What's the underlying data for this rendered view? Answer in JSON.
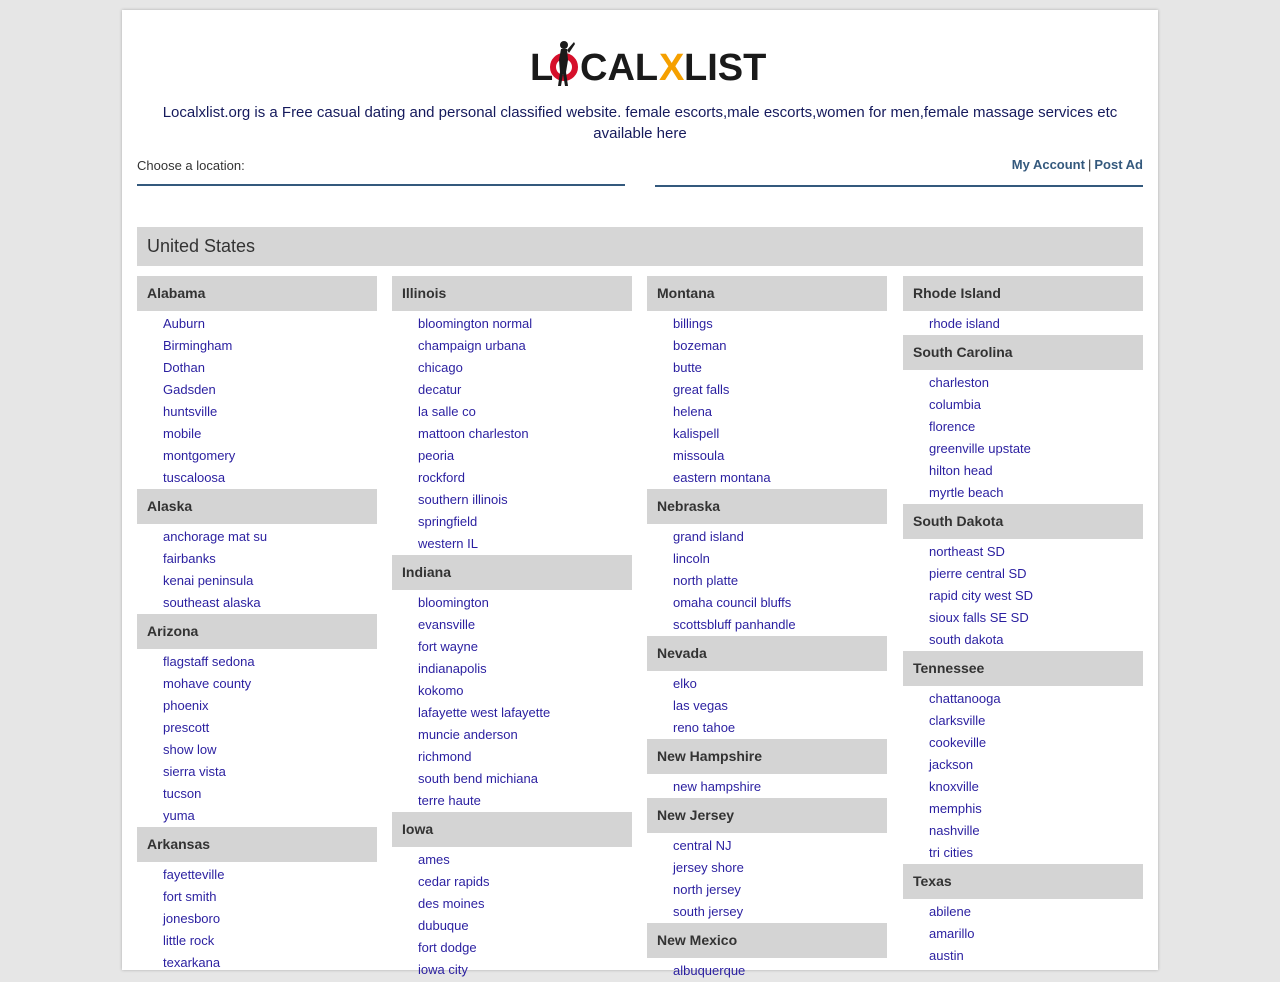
{
  "logo": {
    "text_left": "L",
    "text_o": "O",
    "text_cal": "CAL",
    "text_x": "X",
    "text_list": "LIST",
    "alt": "LOCALXLIST"
  },
  "tagline": "Localxlist.org is a Free casual dating and personal classified website. female escorts,male escorts,women for men,female massage services etc available here",
  "location": {
    "label": "Choose a location:"
  },
  "account": {
    "my_account": "My Account",
    "separator": "|",
    "post_ad": "Post Ad"
  },
  "country": "United States",
  "columns": [
    [
      {
        "state": "Alabama",
        "cities": [
          "Auburn",
          "Birmingham",
          "Dothan",
          "Gadsden",
          "huntsville",
          "mobile",
          "montgomery",
          "tuscaloosa"
        ]
      },
      {
        "state": "Alaska",
        "cities": [
          "anchorage mat su",
          "fairbanks",
          "kenai peninsula",
          "southeast alaska"
        ]
      },
      {
        "state": "Arizona",
        "cities": [
          "flagstaff sedona",
          "mohave county",
          "phoenix",
          "prescott",
          "show low",
          "sierra vista",
          "tucson",
          "yuma"
        ]
      },
      {
        "state": "Arkansas",
        "cities": [
          "fayetteville",
          "fort smith",
          "jonesboro",
          "little rock",
          "texarkana"
        ]
      }
    ],
    [
      {
        "state": "Illinois",
        "cities": [
          "bloomington normal",
          "champaign urbana",
          "chicago",
          "decatur",
          "la salle co",
          "mattoon charleston",
          "peoria",
          "rockford",
          "southern illinois",
          "springfield",
          "western IL"
        ]
      },
      {
        "state": "Indiana",
        "cities": [
          "bloomington",
          "evansville",
          "fort wayne",
          "indianapolis",
          "kokomo",
          "lafayette west lafayette",
          "muncie anderson",
          "richmond",
          "south bend michiana",
          "terre haute"
        ]
      },
      {
        "state": "Iowa",
        "cities": [
          "ames",
          "cedar rapids",
          "des moines",
          "dubuque",
          "fort dodge",
          "iowa city"
        ]
      }
    ],
    [
      {
        "state": "Montana",
        "cities": [
          "billings",
          "bozeman",
          "butte",
          "great falls",
          "helena",
          "kalispell",
          "missoula",
          "eastern montana"
        ]
      },
      {
        "state": "Nebraska",
        "cities": [
          "grand island",
          "lincoln",
          "north platte",
          "omaha council bluffs",
          "scottsbluff panhandle"
        ]
      },
      {
        "state": "Nevada",
        "cities": [
          "elko",
          "las vegas",
          "reno tahoe"
        ]
      },
      {
        "state": "New Hampshire",
        "cities": [
          "new hampshire"
        ]
      },
      {
        "state": "New Jersey",
        "cities": [
          "central NJ",
          "jersey shore",
          "north jersey",
          "south jersey"
        ]
      },
      {
        "state": "New Mexico",
        "cities": [
          "albuquerque"
        ]
      }
    ],
    [
      {
        "state": "Rhode Island",
        "cities": [
          "rhode island"
        ]
      },
      {
        "state": "South Carolina",
        "cities": [
          "charleston",
          "columbia",
          "florence",
          "greenville upstate",
          "hilton head",
          "myrtle beach"
        ]
      },
      {
        "state": "South Dakota",
        "cities": [
          "northeast SD",
          "pierre central SD",
          "rapid city west SD",
          "sioux falls SE SD",
          "south dakota"
        ]
      },
      {
        "state": "Tennessee",
        "cities": [
          "chattanooga",
          "clarksville",
          "cookeville",
          "jackson",
          "knoxville",
          "memphis",
          "nashville",
          "tri cities"
        ]
      },
      {
        "state": "Texas",
        "cities": [
          "abilene",
          "amarillo",
          "austin"
        ]
      }
    ]
  ]
}
